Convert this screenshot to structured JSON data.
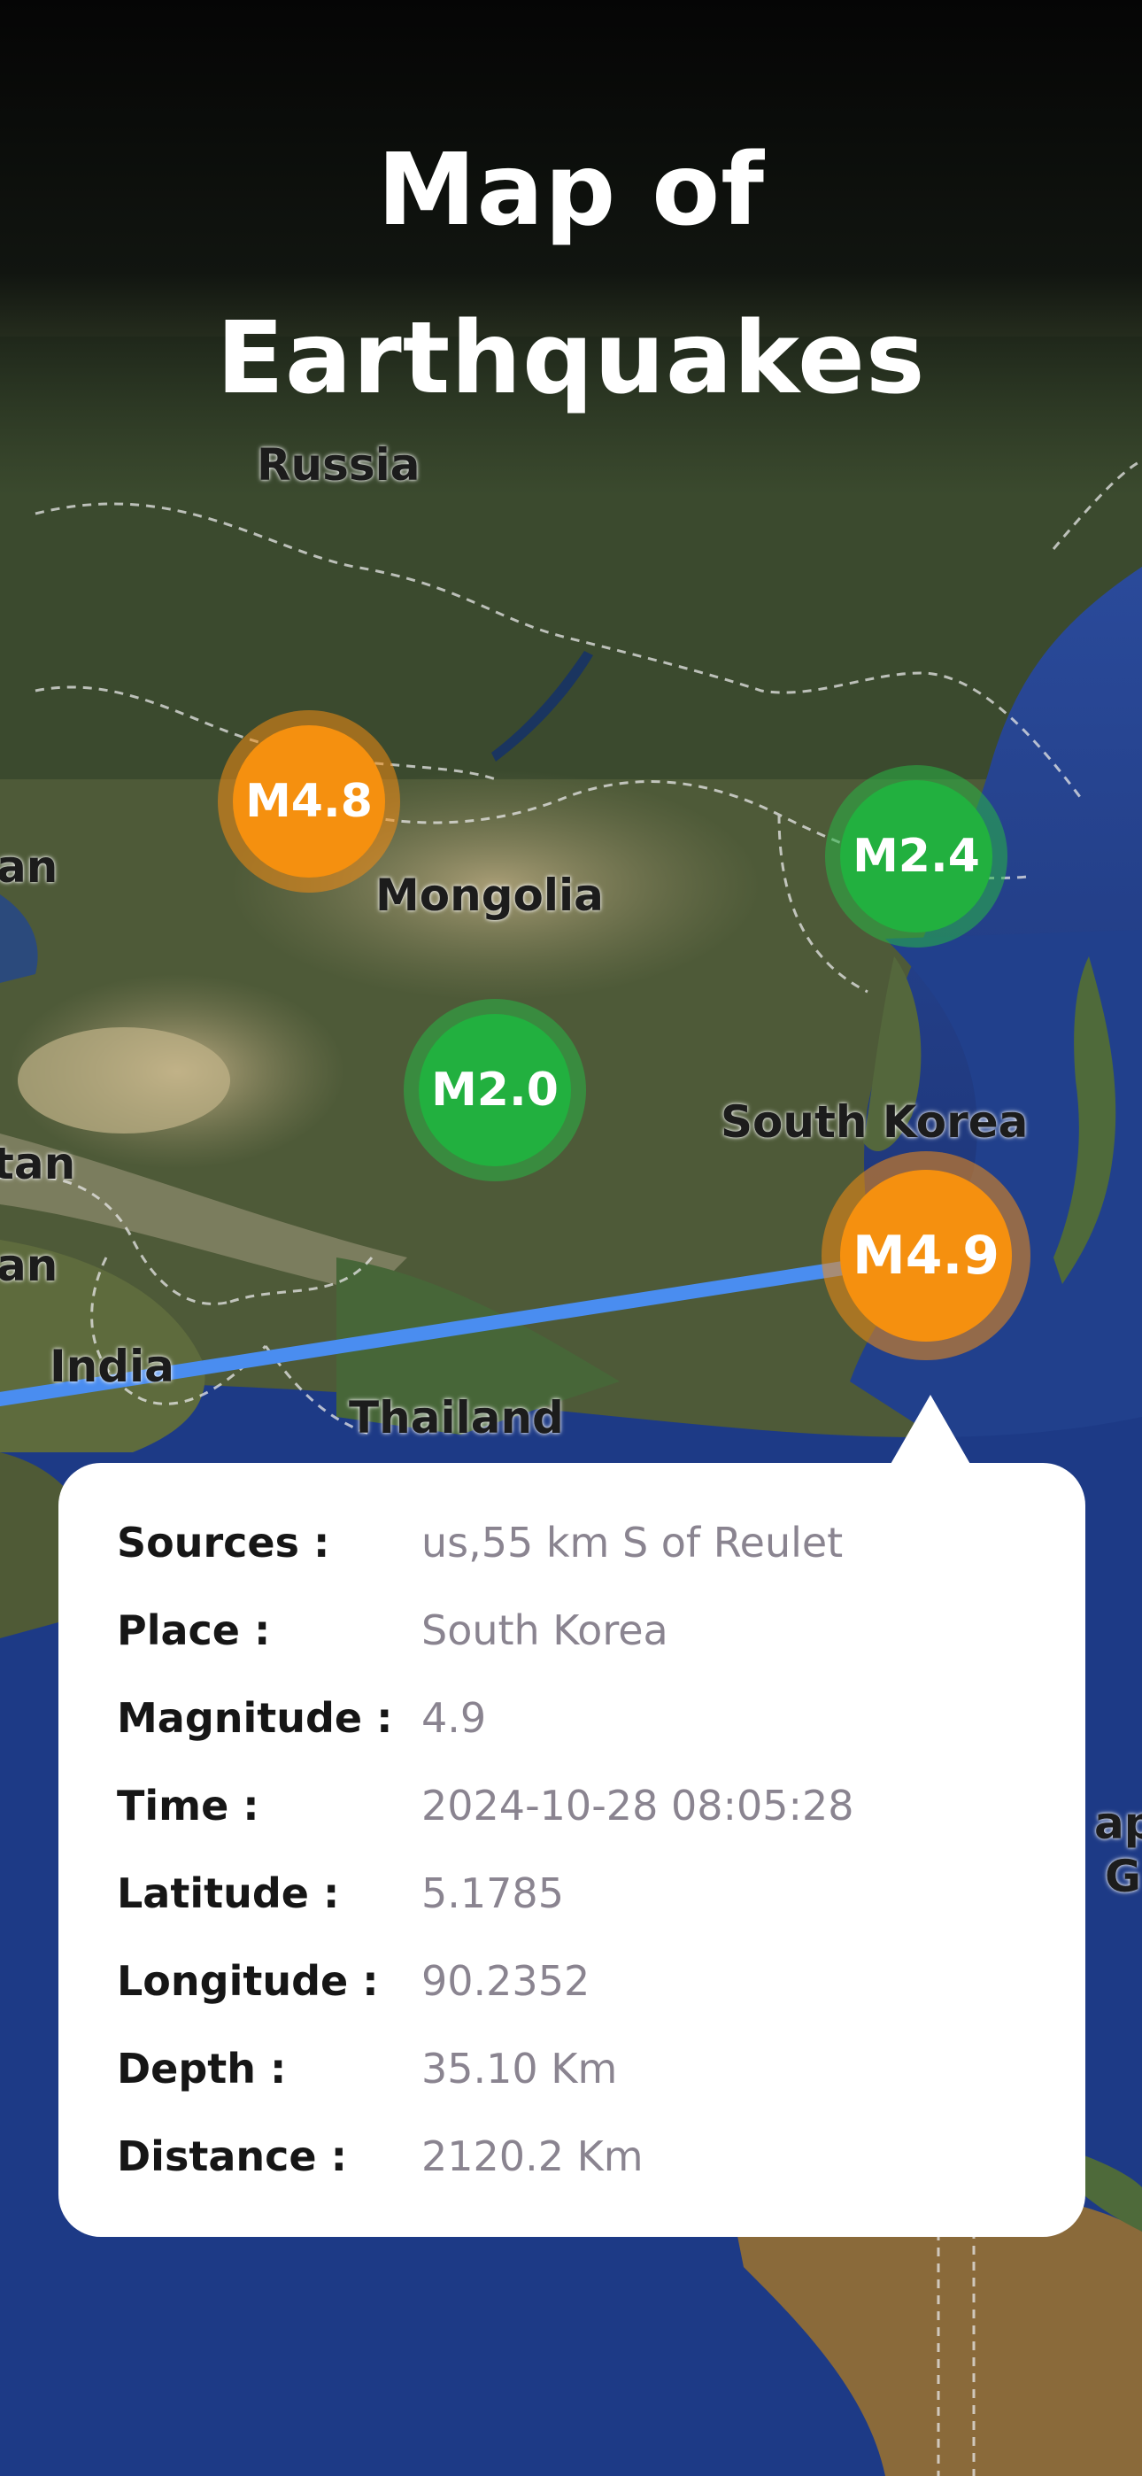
{
  "header": {
    "title_line1": "Map of",
    "title_line2": "Earthquakes"
  },
  "map": {
    "labels": {
      "russia": "Russia",
      "mongolia": "Mongolia",
      "south_korea": "South Korea",
      "india": "India",
      "thailand": "Thailand",
      "edge_an_1": "an",
      "edge_tan": "tan",
      "edge_an_2": "an",
      "edge_ap": "ap",
      "edge_g": "G"
    },
    "markers": [
      {
        "label": "M4.8",
        "severity": "orange"
      },
      {
        "label": "M2.4",
        "severity": "green"
      },
      {
        "label": "M2.0",
        "severity": "green"
      },
      {
        "label": "M4.9",
        "severity": "orange"
      }
    ]
  },
  "details": {
    "sources_key": "Sources :",
    "sources_val": "us,55 km S of Reulet",
    "place_key": "Place :",
    "place_val": "South Korea",
    "magnitude_key": "Magnitude :",
    "magnitude_val": "4.9",
    "time_key": "Time :",
    "time_val": "2024-10-28 08:05:28",
    "latitude_key": "Latitude :",
    "latitude_val": "5.1785",
    "longitude_key": "Longitude :",
    "longitude_val": "90.2352",
    "depth_key": "Depth :",
    "depth_val": "35.10 Km",
    "distance_key": "Distance :",
    "distance_val": "2120.2 Km"
  },
  "colors": {
    "marker_orange": "#f5900f",
    "marker_green": "#22b03f",
    "route_line": "#4a8df0",
    "ocean": "#1f3d8a",
    "land": "#6f7b4a"
  }
}
